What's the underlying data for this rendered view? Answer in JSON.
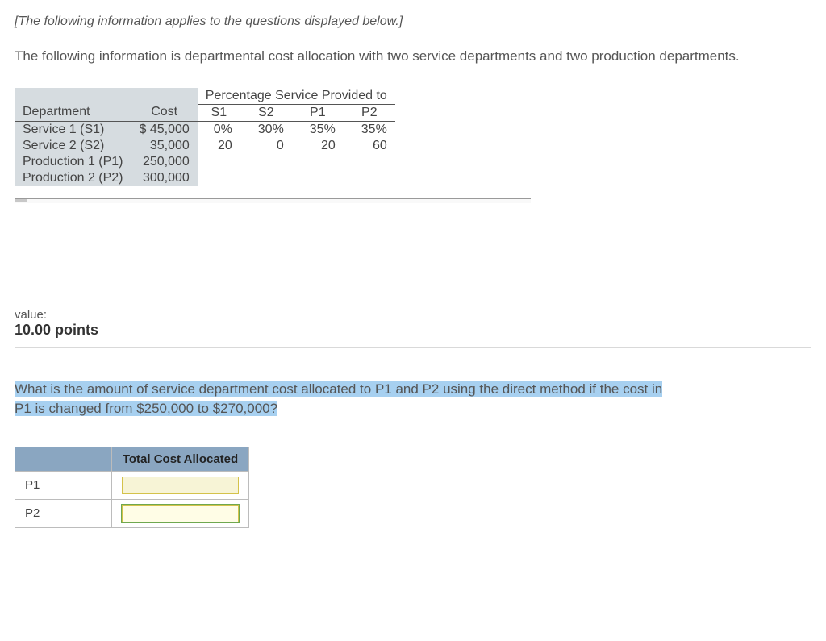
{
  "intro_italic": "[The following information applies to the questions displayed below.]",
  "intro_text": "The following information is departmental cost allocation with two service departments and two production departments.",
  "allocation_table": {
    "col_headers": {
      "dept": "Department",
      "cost": "Cost",
      "pct_header": "Percentage Service Provided to",
      "s1": "S1",
      "s2": "S2",
      "p1": "P1",
      "p2": "P2"
    },
    "rows": [
      {
        "dept": "Service 1 (S1)",
        "cost": "$ 45,000",
        "s1": "0%",
        "s2": "30%",
        "p1": "35%",
        "p2": "35%"
      },
      {
        "dept": "Service 2 (S2)",
        "cost": "35,000",
        "s1": "20",
        "s2": "0",
        "p1": "20",
        "p2": "60"
      },
      {
        "dept": "Production 1 (P1)",
        "cost": "250,000",
        "s1": "",
        "s2": "",
        "p1": "",
        "p2": ""
      },
      {
        "dept": "Production 2 (P2)",
        "cost": "300,000",
        "s1": "",
        "s2": "",
        "p1": "",
        "p2": ""
      }
    ]
  },
  "value": {
    "label": "value:",
    "points": "10.00 points"
  },
  "question": {
    "line1": "What is the amount of service department cost allocated to P1 and P2 using the direct method if the cost in",
    "line2": "P1 is changed from $250,000 to $270,000?"
  },
  "answer_table": {
    "header": "Total Cost Allocated",
    "rows": [
      "P1",
      "P2"
    ]
  }
}
